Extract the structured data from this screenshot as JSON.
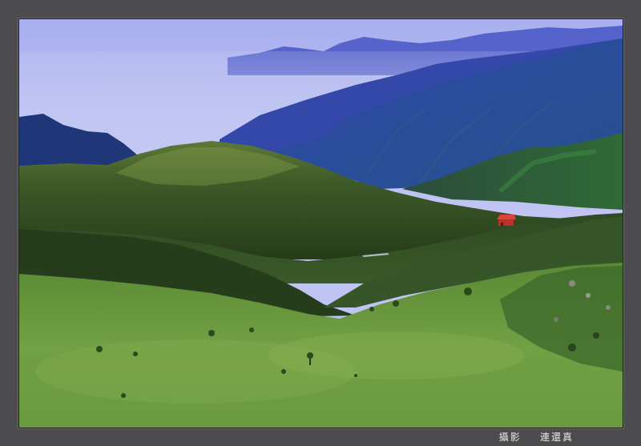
{
  "photo": {
    "subject": "landscape",
    "colors": {
      "sky_top": "#a7b3f0",
      "sky_haze": "#c9c6f2",
      "far_ridge": "#3f4fbf",
      "mid_ridge": "#2c3f9e",
      "blue_mountain": "#2e4e9a",
      "dark_left_hill": "#1e3270",
      "grass_dark": "#2d4a22",
      "grass_mid": "#4f7a2e",
      "grass_light": "#7ea34c",
      "roof_red": "#c8382c"
    }
  },
  "credit": {
    "label": "攝影",
    "author": "連還真"
  }
}
